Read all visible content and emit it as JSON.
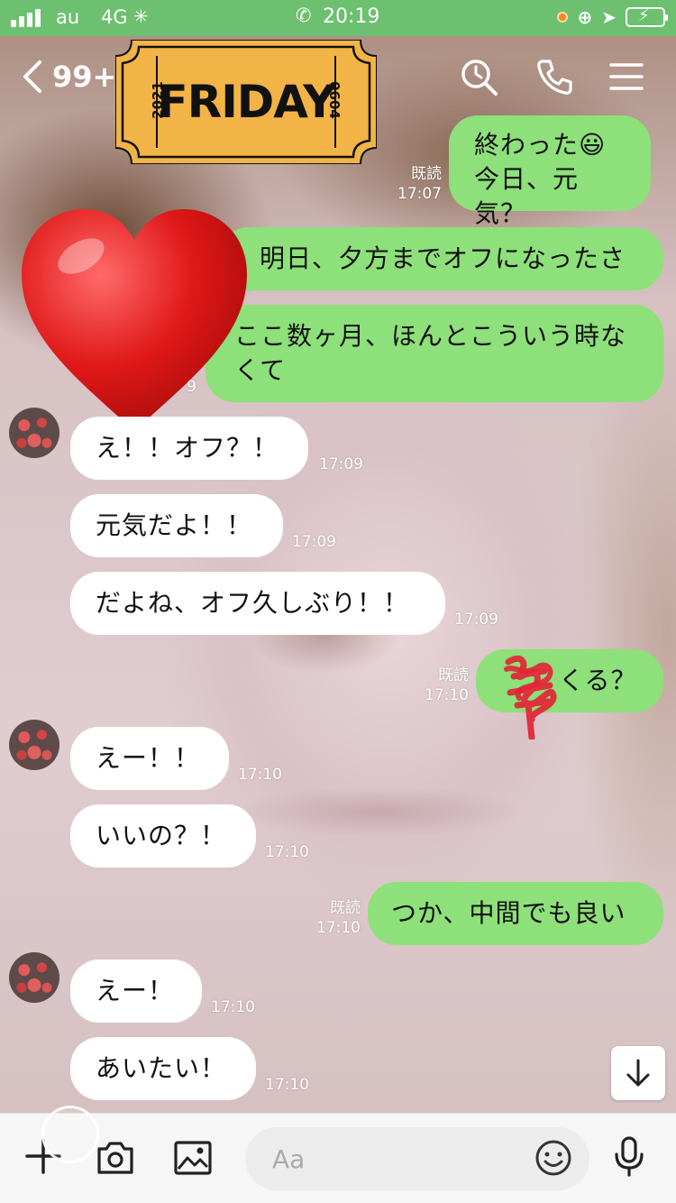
{
  "status_bar": {
    "carrier": "au",
    "network": "4G",
    "time": "20:19"
  },
  "header": {
    "unread_count": "99+",
    "icons": [
      "search-icon",
      "phone-icon",
      "menu-icon"
    ]
  },
  "stickers": {
    "ticket": {
      "title": "FRIDAY",
      "year": "2021",
      "date": "0604",
      "color": "#f2b446"
    },
    "heart": {
      "color": "#e11d1d"
    }
  },
  "messages": [
    {
      "dir": "out",
      "lines": [
        "終わった😃",
        "今日、元気？"
      ],
      "read": "既読",
      "time": "17:07"
    },
    {
      "dir": "out",
      "lines": [
        "明日、夕方までオフになったさ"
      ]
    },
    {
      "dir": "out",
      "lines": [
        "ここ数ヶ月、ほんとこういう時な",
        "くて"
      ],
      "time_partial": "9"
    },
    {
      "dir": "in",
      "text": "え！！オフ？！",
      "time": "17:09"
    },
    {
      "dir": "in",
      "text": "元気だよ！！",
      "time": "17:09"
    },
    {
      "dir": "in",
      "text": "だよね、オフ久しぶり！！",
      "time": "17:09"
    },
    {
      "dir": "out",
      "text": "くる？",
      "read": "既読",
      "time": "17:10"
    },
    {
      "dir": "in",
      "text": "えー！！",
      "time": "17:10"
    },
    {
      "dir": "in",
      "text": "いいの？！",
      "time": "17:10"
    },
    {
      "dir": "out",
      "text": "つか、中間でも良い",
      "read": "既読",
      "time": "17:10"
    },
    {
      "dir": "in",
      "text": "えー！",
      "time": "17:10"
    },
    {
      "dir": "in",
      "text": "あいたい！",
      "time": "17:10"
    }
  ],
  "input": {
    "placeholder": "Aa",
    "icons": [
      "plus-icon",
      "camera-icon",
      "image-icon",
      "emoji-icon",
      "microphone-icon"
    ]
  },
  "colors": {
    "status_bar": "#6cc06f",
    "bubble_out": "#8de07a",
    "bubble_in": "#ffffff"
  }
}
